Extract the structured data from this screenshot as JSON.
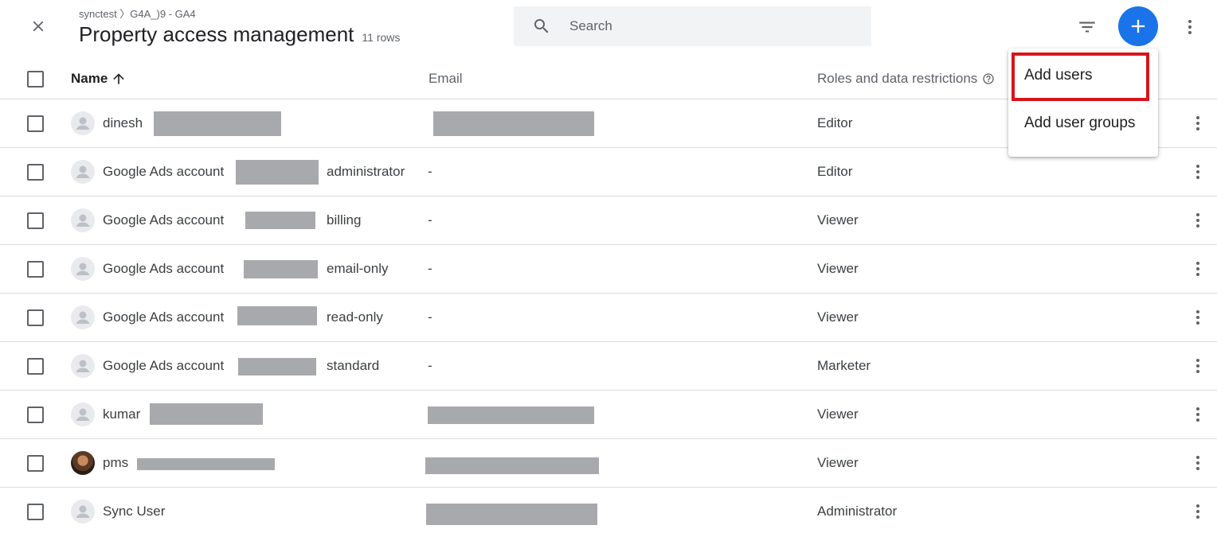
{
  "header": {
    "breadcrumb": "synctest 〉G4A_)9 - GA4",
    "title": "Property access management",
    "row_count": "11 rows"
  },
  "search": {
    "placeholder": "Search",
    "value": ""
  },
  "columns": {
    "name": "Name",
    "email": "Email",
    "roles": "Roles and data restrictions"
  },
  "rows": [
    {
      "name": "dinesh",
      "suffix": "",
      "email": "",
      "role": "Editor"
    },
    {
      "name": "Google Ads account",
      "suffix": "administrator",
      "email": "-",
      "role": "Editor"
    },
    {
      "name": "Google Ads account",
      "suffix": "billing",
      "email": "-",
      "role": "Viewer"
    },
    {
      "name": "Google Ads account",
      "suffix": "email-only",
      "email": "-",
      "role": "Viewer"
    },
    {
      "name": "Google Ads account",
      "suffix": "read-only",
      "email": "-",
      "role": "Viewer"
    },
    {
      "name": "Google Ads account",
      "suffix": "standard",
      "email": "-",
      "role": "Marketer"
    },
    {
      "name": "kumar",
      "suffix": "",
      "email": "",
      "role": "Viewer"
    },
    {
      "name": "pms",
      "suffix": "",
      "email": "",
      "role": "Viewer"
    },
    {
      "name": "Sync User",
      "suffix": "",
      "email": "",
      "role": "Administrator"
    }
  ],
  "menu": {
    "items": [
      "Add users",
      "Add user groups"
    ]
  },
  "colors": {
    "accent": "#1a73e8",
    "highlight": "#d7141b",
    "redaction": "#a8a9ad"
  },
  "icons": [
    "close-icon",
    "search-icon",
    "filter-icon",
    "add-icon",
    "more-vert-icon",
    "arrow-up-icon",
    "help-icon",
    "user-avatar-icon"
  ]
}
